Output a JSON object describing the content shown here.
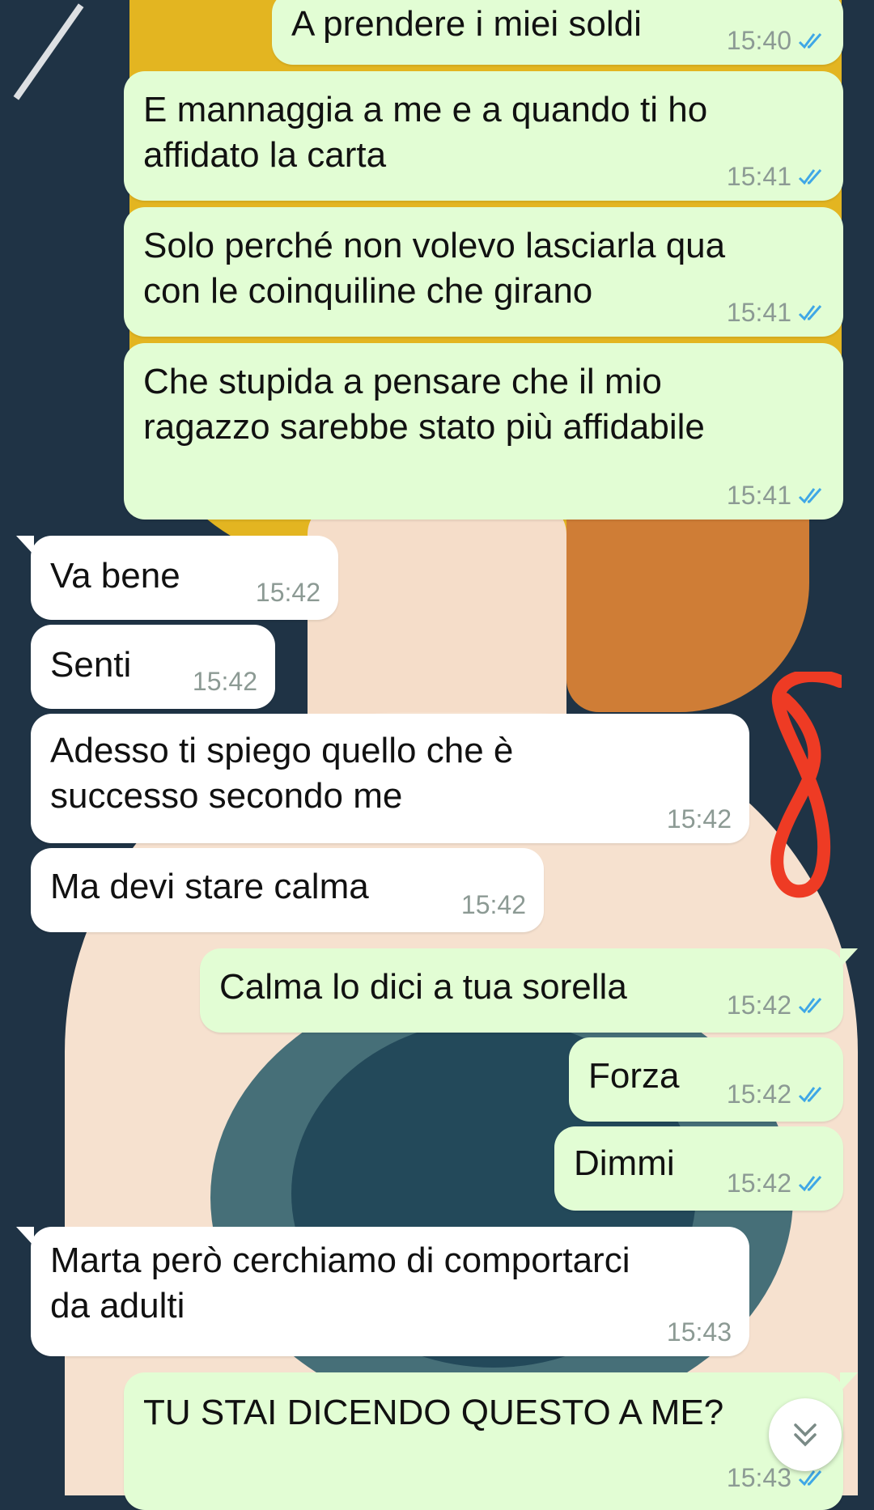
{
  "colors": {
    "outgoing_bubble": "#e2fdd4",
    "incoming_bubble": "#ffffff",
    "read_ticks": "#3fa7e6",
    "timestamp": "#8c9a94",
    "annotation": "#ee3b24"
  },
  "messages": [
    {
      "dir": "out",
      "text": "A prendere i miei soldi",
      "time": "15:40",
      "status": "read"
    },
    {
      "dir": "out",
      "text": "E mannaggia a me e a  quando ti ho\naffidato la carta",
      "time": "15:41",
      "status": "read"
    },
    {
      "dir": "out",
      "text": "Solo perché non volevo lasciarla qua\ncon le coinquiline che girano",
      "time": "15:41",
      "status": "read"
    },
    {
      "dir": "out",
      "text": "Che stupida a pensare che il mio\nragazzo sarebbe stato più affidabile",
      "time": "15:41",
      "status": "read"
    },
    {
      "dir": "in",
      "text": "Va bene",
      "time": "15:42"
    },
    {
      "dir": "in",
      "text": "Senti",
      "time": "15:42"
    },
    {
      "dir": "in",
      "text": "Adesso ti spiego quello che è\nsuccesso secondo me",
      "time": "15:42"
    },
    {
      "dir": "in",
      "text": "Ma devi stare calma",
      "time": "15:42"
    },
    {
      "dir": "out",
      "text": "Calma lo dici a tua sorella",
      "time": "15:42",
      "status": "read"
    },
    {
      "dir": "out",
      "text": "Forza",
      "time": "15:42",
      "status": "read"
    },
    {
      "dir": "out",
      "text": "Dimmi",
      "time": "15:42",
      "status": "read"
    },
    {
      "dir": "in",
      "text": "Marta però cerchiamo di comportarci\nda adulti",
      "time": "15:43"
    },
    {
      "dir": "out",
      "text": "TU STAI DICENDO QUESTO A ME?",
      "time": "15:43",
      "status": "read"
    }
  ],
  "icons": {
    "read_receipt": "double-check-icon",
    "scroll_down": "double-chevron-down-icon"
  }
}
